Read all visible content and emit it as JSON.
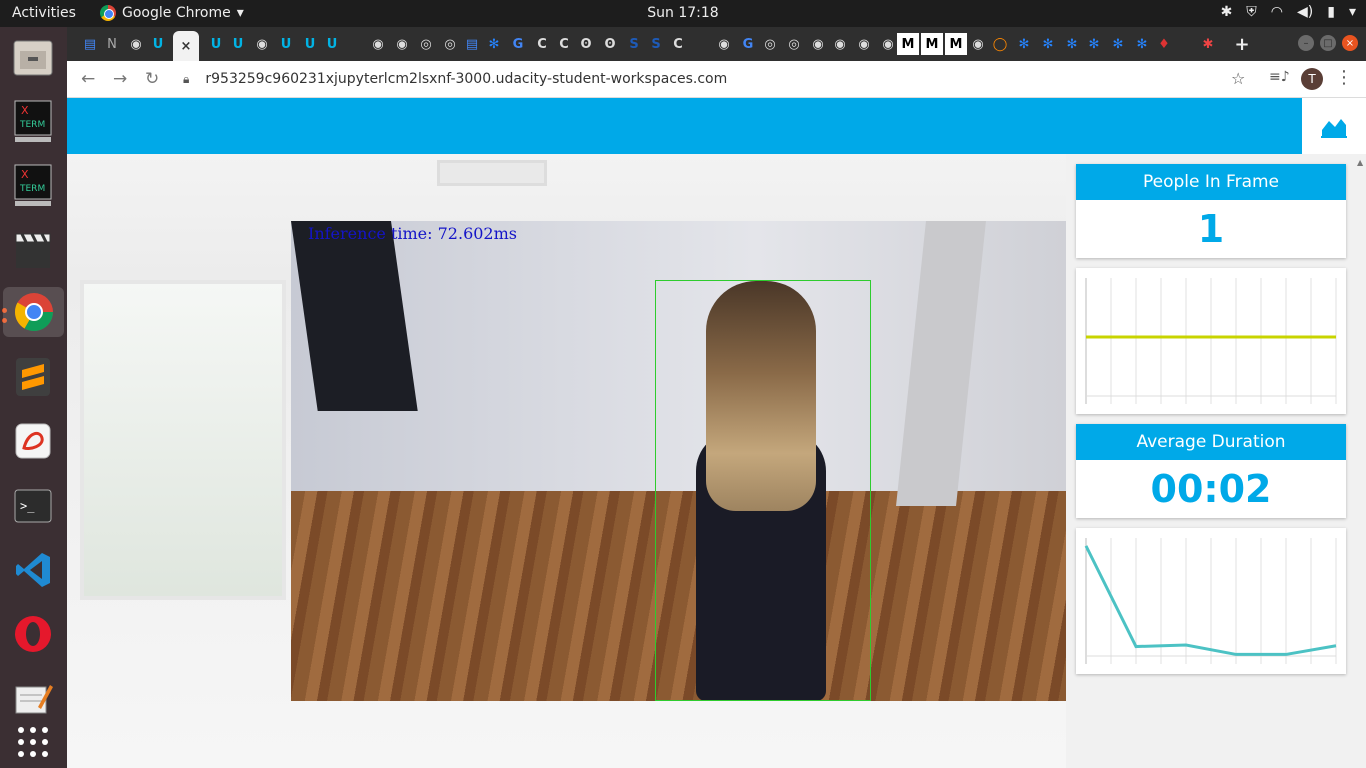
{
  "topbar": {
    "activities": "Activities",
    "app_name": "Google Chrome",
    "clock": "Sun 17:18"
  },
  "dock": {
    "items": [
      "files-icon",
      "xterm-icon",
      "xterm-icon",
      "clapper-icon",
      "chrome-icon",
      "sublime-icon",
      "evince-icon",
      "terminal-icon",
      "vscode-icon",
      "opera-icon",
      "editor-icon",
      "app-grid-icon"
    ]
  },
  "tabs": {
    "active_close": "×",
    "new_tab": "+"
  },
  "address_bar": {
    "url": "r953259c960231xjupyterlcm2lsxnf-3000.udacity-student-workspaces.com",
    "profile_initial": "T"
  },
  "video": {
    "inference_text": "Inference time: 72.602ms"
  },
  "panel": {
    "people_title": "People In Frame",
    "people_value": "1",
    "duration_title": "Average Duration",
    "duration_value": "00:02"
  },
  "colors": {
    "accent": "#00a9e8",
    "people_line": "#c8d400",
    "duration_line": "#4cc2c4",
    "bbox": "#2ecc2e"
  },
  "chart_data": [
    {
      "type": "line",
      "series": [
        {
          "values": [
            1,
            1,
            1,
            1,
            1,
            1,
            1,
            1,
            1,
            1,
            1,
            1
          ]
        }
      ],
      "ylim": [
        0,
        2
      ]
    },
    {
      "type": "line",
      "series": [
        {
          "values": [
            14,
            1.2,
            1.4,
            0.2,
            0.2,
            1.3
          ]
        }
      ],
      "ylim": [
        0,
        15
      ]
    }
  ]
}
